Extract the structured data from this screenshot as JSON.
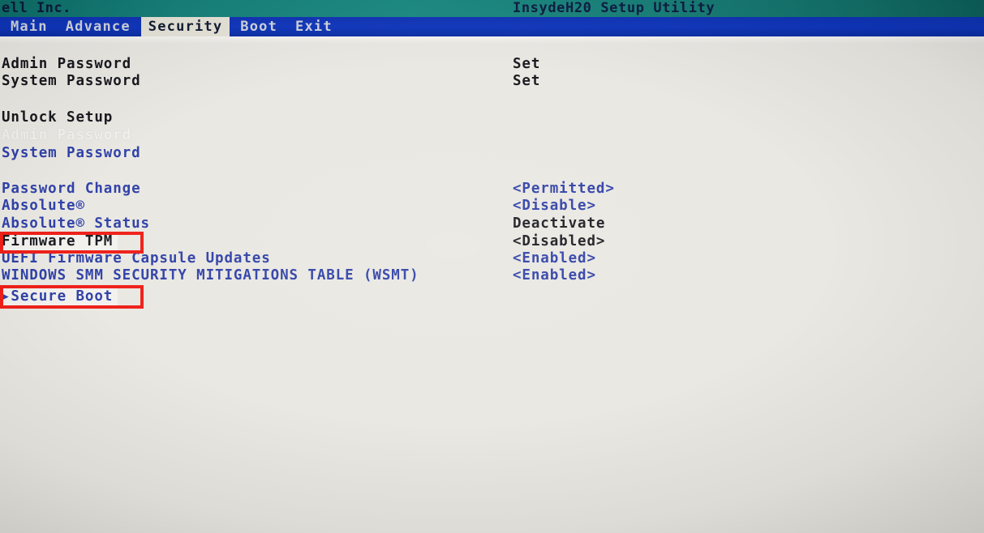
{
  "titlebar": {
    "vendor": "ell Inc.",
    "utility": "InsydeH20 Setup Utility"
  },
  "menubar": {
    "tabs": [
      {
        "label": "Main",
        "active": false
      },
      {
        "label": "Advance",
        "active": false
      },
      {
        "label": "Security",
        "active": true
      },
      {
        "label": "Boot",
        "active": false
      },
      {
        "label": "Exit",
        "active": false
      }
    ]
  },
  "settings": {
    "rows": [
      {
        "label": "Admin Password",
        "value": "Set",
        "label_color": "dark",
        "value_color": "dark",
        "selected": false,
        "submenu": false
      },
      {
        "label": "System Password",
        "value": "Set",
        "label_color": "dark",
        "value_color": "dark",
        "selected": false,
        "submenu": false
      },
      {
        "label": "Unlock Setup",
        "value": "",
        "label_color": "dark",
        "value_color": "dark",
        "selected": false,
        "submenu": false
      },
      {
        "label": "Admin Password",
        "value": "",
        "label_color": "white",
        "value_color": "white",
        "selected": false,
        "submenu": false
      },
      {
        "label": "System Password",
        "value": "",
        "label_color": "blue",
        "value_color": "blue",
        "selected": false,
        "submenu": false
      },
      {
        "label": "Password Change",
        "value": "<Permitted>",
        "label_color": "blue",
        "value_color": "blue",
        "selected": false,
        "submenu": false
      },
      {
        "label": "Absolute®",
        "value": "<Disable>",
        "label_color": "blue",
        "value_color": "blue",
        "selected": false,
        "submenu": false
      },
      {
        "label": "Absolute® Status",
        "value": "Deactivate",
        "label_color": "blue",
        "value_color": "dark",
        "selected": false,
        "submenu": false
      },
      {
        "label": "Firmware TPM",
        "value": "<Disabled>",
        "label_color": "dark",
        "value_color": "dark",
        "selected": true,
        "submenu": false
      },
      {
        "label": "UEFI Firmware Capsule Updates",
        "value": "<Enabled>",
        "label_color": "blue",
        "value_color": "blue",
        "selected": false,
        "submenu": false
      },
      {
        "label": "WINDOWS SMM SECURITY MITIGATIONS TABLE (WSMT)",
        "value": "<Enabled>",
        "label_color": "blue",
        "value_color": "blue",
        "selected": false,
        "submenu": false
      },
      {
        "label": "▸Secure Boot",
        "value": "",
        "label_color": "blue",
        "value_color": "blue",
        "selected": true,
        "submenu": true
      }
    ]
  },
  "annotations": [
    {
      "name": "firmware-tpm-highlight",
      "color": "#ee1b14"
    },
    {
      "name": "secure-boot-highlight",
      "color": "#ee1b14"
    }
  ]
}
